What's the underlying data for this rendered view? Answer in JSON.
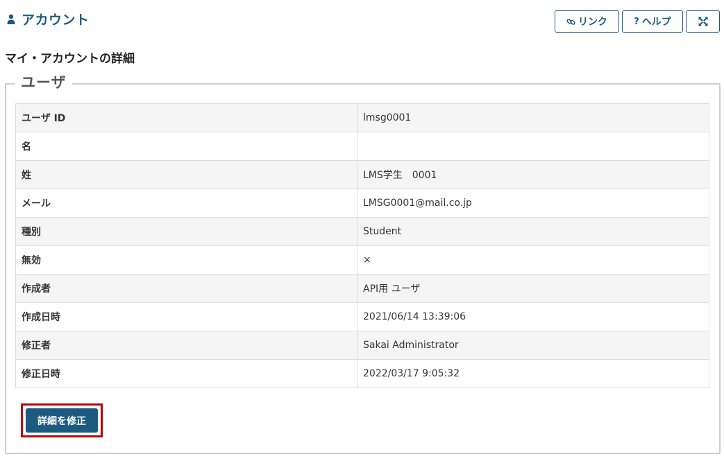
{
  "header": {
    "title": "アカウント",
    "icon": "user-icon"
  },
  "toolbar": {
    "link_label": "リンク",
    "link_icon": "link-icon",
    "help_label": "ヘルプ",
    "help_icon_glyph": "?",
    "expand_icon": "expand-icon"
  },
  "section": {
    "title": "マイ・アカウントの詳細",
    "legend": "ユーザ"
  },
  "details": {
    "rows": [
      {
        "label": "ユーザ ID",
        "value": "lmsg0001"
      },
      {
        "label": "名",
        "value": ""
      },
      {
        "label": "姓",
        "value": "LMS学生　0001"
      },
      {
        "label": "メール",
        "value": "LMSG0001@mail.co.jp"
      },
      {
        "label": "種別",
        "value": "Student"
      },
      {
        "label": "無効",
        "value": "×"
      },
      {
        "label": "作成者",
        "value": "API用 ユーザ"
      },
      {
        "label": "作成日時",
        "value": "2021/06/14 13:39:06"
      },
      {
        "label": "修正者",
        "value": "Sakai Administrator"
      },
      {
        "label": "修正日時",
        "value": "2022/03/17 9:05:32"
      }
    ]
  },
  "actions": {
    "edit_label": "詳細を修正"
  },
  "colors": {
    "accent": "#1d5a80",
    "highlight": "#c00000"
  }
}
